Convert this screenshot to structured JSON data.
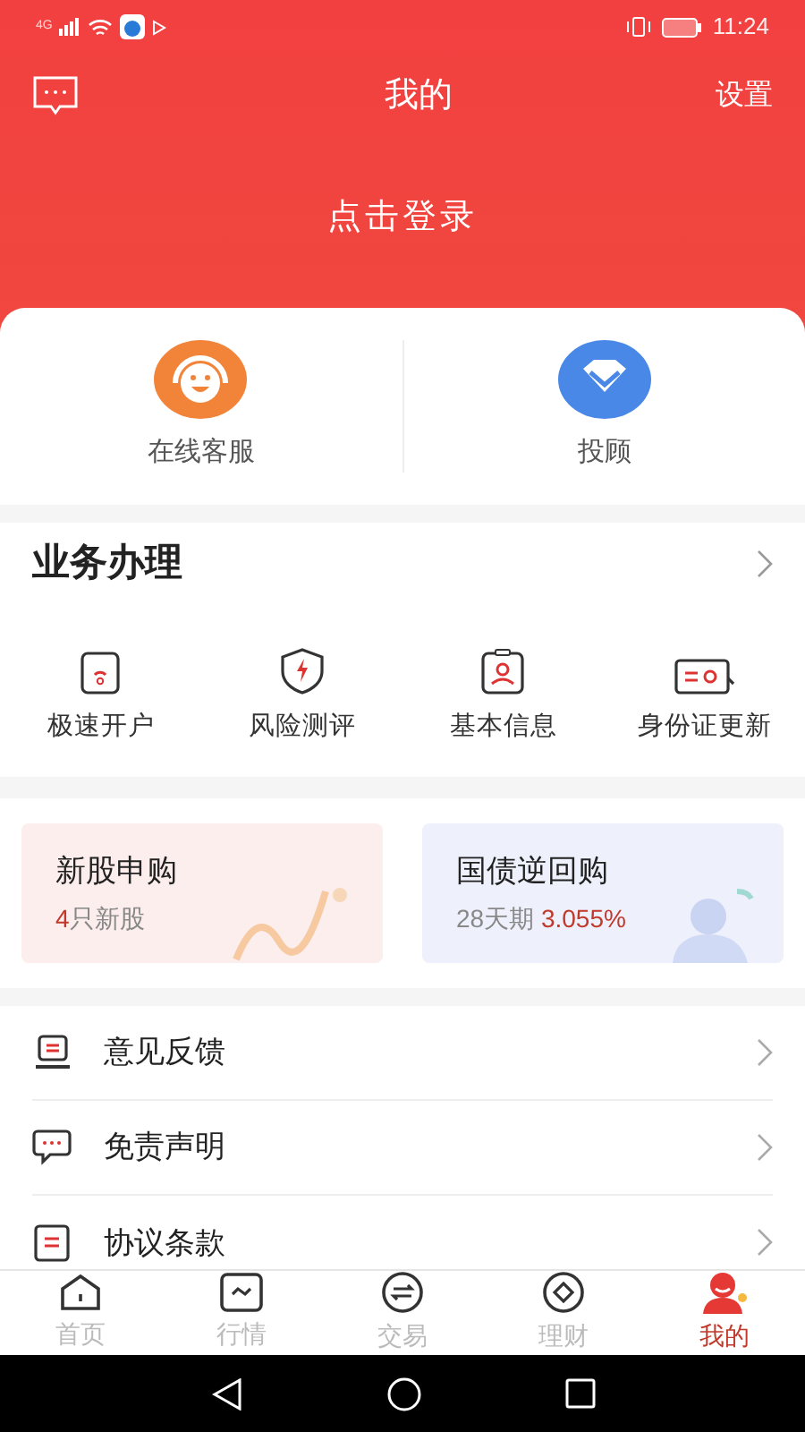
{
  "status_bar": {
    "network": "4G",
    "time": "11:24"
  },
  "header": {
    "title": "我的",
    "settings": "设置",
    "login": "点击登录"
  },
  "services": [
    {
      "kind": "support",
      "label": "在线客服"
    },
    {
      "kind": "advisor",
      "label": "投顾"
    }
  ],
  "business": {
    "title": "业务办理",
    "items": [
      {
        "kind": "account",
        "label": "极速开户"
      },
      {
        "kind": "risk",
        "label": "风险测评"
      },
      {
        "kind": "info",
        "label": "基本信息"
      },
      {
        "kind": "id",
        "label": "身份证更新"
      }
    ]
  },
  "promo_cards": [
    {
      "kind": "ipo",
      "title": "新股申购",
      "count": "4",
      "subtitle": "只新股"
    },
    {
      "kind": "repo",
      "title": "国债逆回购",
      "subtitle": "28天期",
      "rate": "3.055%"
    }
  ],
  "menu": [
    {
      "kind": "feedback",
      "label": "意见反馈"
    },
    {
      "kind": "disclaimer",
      "label": "免责声明"
    },
    {
      "kind": "terms",
      "label": "协议条款"
    }
  ],
  "tabs": [
    {
      "kind": "home",
      "label": "首页",
      "selected": false
    },
    {
      "kind": "market",
      "label": "行情",
      "selected": false
    },
    {
      "kind": "trade",
      "label": "交易",
      "selected": false
    },
    {
      "kind": "wealth",
      "label": "理财",
      "selected": false
    },
    {
      "kind": "me",
      "label": "我的",
      "selected": true
    }
  ]
}
